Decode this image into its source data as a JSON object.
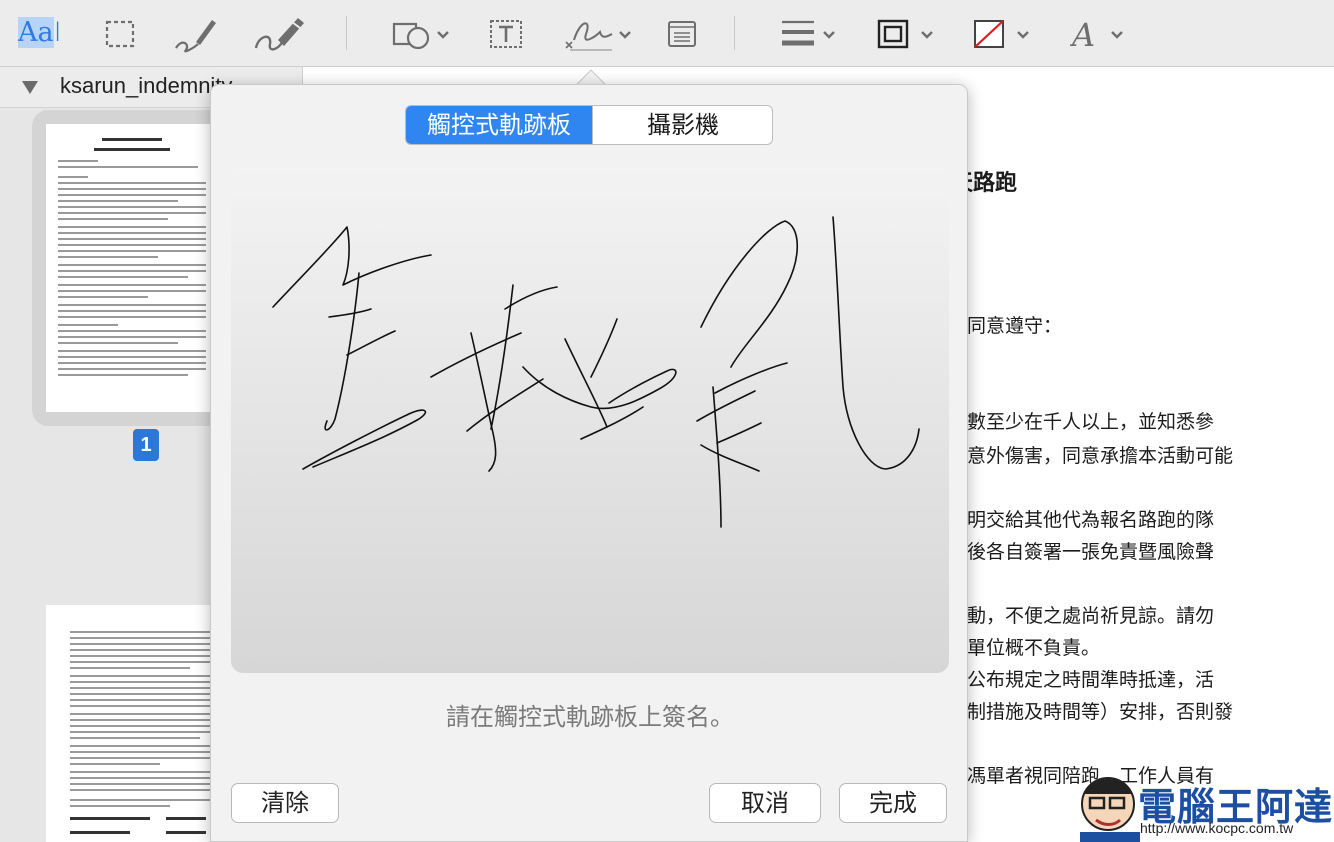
{
  "toolbar": {
    "text_style_label": "Aa",
    "items": [
      "text-style",
      "rect-selection",
      "sketch",
      "draw",
      "shapes",
      "text-box",
      "sign",
      "note",
      "line-style",
      "border-color",
      "fill-color",
      "text-font"
    ]
  },
  "sidebar": {
    "file_name": "ksarun_indemnity",
    "page_number": "1"
  },
  "document": {
    "heading": "天路跑",
    "lines": [
      "同意遵守：",
      "數至少在千人以上，並知悉參",
      "意外傷害，同意承擔本活動可能",
      "明交給其他代為報名路跑的隊",
      "後各自簽署一張免責暨風險聲",
      "動，不便之處尚祈見諒。請勿",
      "單位概不負責。",
      "公布規定之時間準時抵達，活",
      "制措施及時間等）安排，否則發",
      "馮單者視同陪跑，工作人員有"
    ]
  },
  "signature_dialog": {
    "tabs": [
      {
        "label": "觸控式軌跡板",
        "active": true
      },
      {
        "label": "攝影機",
        "active": false
      }
    ],
    "hint": "請在觸控式軌跡板上簽名。",
    "clear_label": "清除",
    "cancel_label": "取消",
    "done_label": "完成"
  },
  "watermark": {
    "brand": "電腦王阿達",
    "url": "http://www.kocpc.com.tw"
  },
  "colors": {
    "accent": "#2f86f0",
    "page_badge": "#2a78d9",
    "watermark_blue": "#1d4fa1"
  }
}
